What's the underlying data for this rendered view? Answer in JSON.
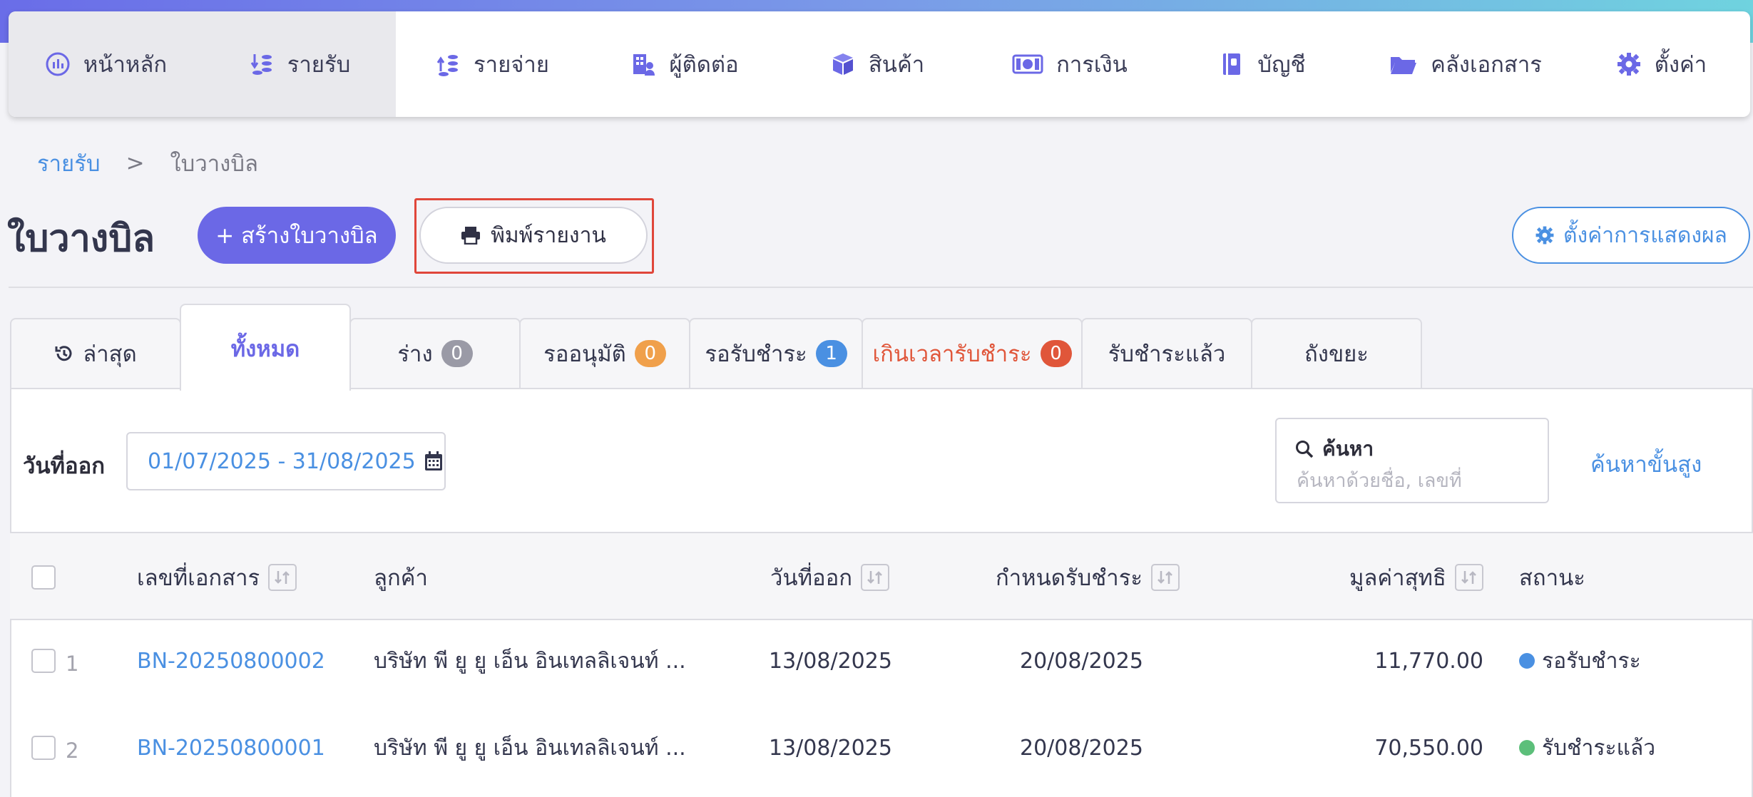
{
  "nav": {
    "items": [
      {
        "label": "หน้าหลัก",
        "icon": "dashboard-icon"
      },
      {
        "label": "รายรับ",
        "icon": "income-icon"
      },
      {
        "label": "รายจ่าย",
        "icon": "expense-icon"
      },
      {
        "label": "ผู้ติดต่อ",
        "icon": "contacts-icon"
      },
      {
        "label": "สินค้า",
        "icon": "product-box-icon"
      },
      {
        "label": "การเงิน",
        "icon": "money-icon"
      },
      {
        "label": "บัญชี",
        "icon": "accounting-book-icon"
      },
      {
        "label": "คลังเอกสาร",
        "icon": "folder-icon"
      },
      {
        "label": "ตั้งค่า",
        "icon": "gear-icon"
      }
    ]
  },
  "breadcrumb": {
    "parent": "รายรับ",
    "separator": ">",
    "current": "ใบวางบิล"
  },
  "page": {
    "title": "ใบวางบิล",
    "create_button": "+ สร้างใบวางบิล",
    "print_button": "พิมพ์รายงาน",
    "display_settings_button": "ตั้งค่าการแสดงผล"
  },
  "tabs": [
    {
      "label": "ล่าสุด"
    },
    {
      "label": "ทั้งหมด"
    },
    {
      "label": "ร่าง",
      "badge": "0"
    },
    {
      "label": "รออนุมัติ",
      "badge": "0"
    },
    {
      "label": "รอรับชำระ",
      "badge": "1"
    },
    {
      "label": "เกินเวลารับชำระ",
      "badge": "0"
    },
    {
      "label": "รับชำระแล้ว"
    },
    {
      "label": "ถังขยะ"
    }
  ],
  "filters": {
    "date_label": "วันที่ออก",
    "date_range": "01/07/2025 - 31/08/2025",
    "search_label": "ค้นหา",
    "search_placeholder": "ค้นหาด้วยชื่อ, เลขที่",
    "advanced_search": "ค้นหาขั้นสูง"
  },
  "table": {
    "headers": {
      "doc_no": "เลขที่เอกสาร",
      "customer": "ลูกค้า",
      "issue_date": "วันที่ออก",
      "due_date": "กำหนดรับชำระ",
      "net_value": "มูลค่าสุทธิ",
      "status": "สถานะ"
    },
    "rows": [
      {
        "num": "1",
        "doc_no": "BN-20250800002",
        "customer": "บริษัท พี ยู ยู เอ็น อินเทลลิเจนท์ ...",
        "issue_date": "13/08/2025",
        "due_date": "20/08/2025",
        "net_value": "11,770.00",
        "status": "รอรับชำระ"
      },
      {
        "num": "2",
        "doc_no": "BN-20250800001",
        "customer": "บริษัท พี ยู ยู เอ็น อินเทลลิเจนท์ ...",
        "issue_date": "13/08/2025",
        "due_date": "20/08/2025",
        "net_value": "70,550.00",
        "status": "รับชำระแล้ว"
      }
    ]
  },
  "colors": {
    "accent": "#6b68e6",
    "link": "#4a90e2",
    "overdue": "#e0563a",
    "badge_gray": "#9a9aa6",
    "badge_orange": "#f0a04b",
    "badge_blue": "#4a90e2",
    "badge_red": "#e0563a",
    "status_pending": "#4a90e2",
    "status_paid": "#5cbf7a"
  }
}
